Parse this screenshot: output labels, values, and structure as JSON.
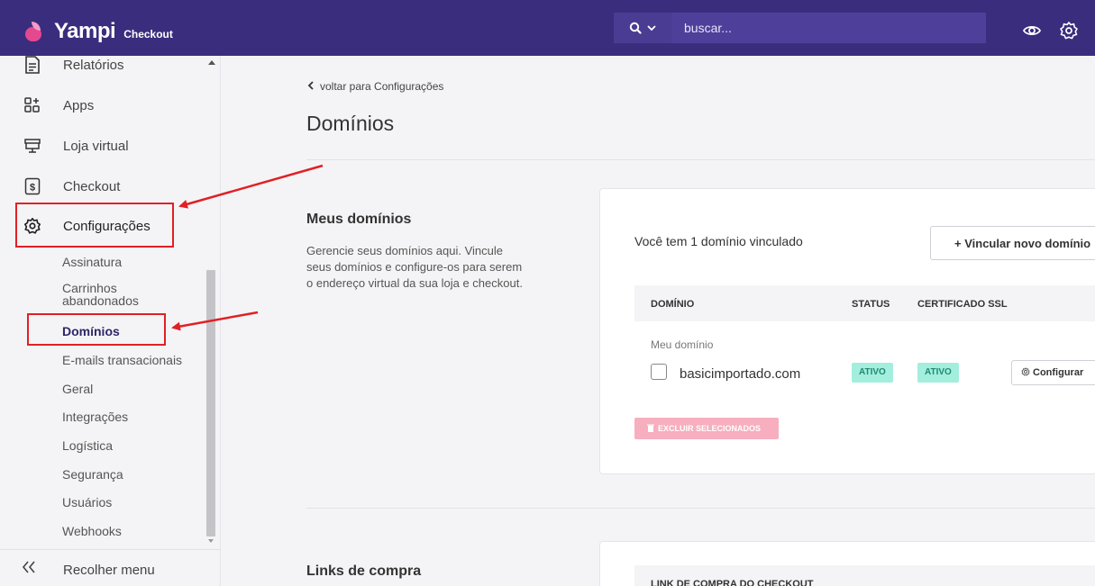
{
  "header": {
    "brand_name": "Yampi",
    "brand_sub": "Checkout",
    "search_placeholder": "buscar...",
    "colors": {
      "bar": "#3b2d7d",
      "search": "#4d3f9a",
      "logo_primary": "#e4488f",
      "logo_secondary": "#f79ac6"
    }
  },
  "sidebar": {
    "items": [
      {
        "label": "Relatórios",
        "icon": "report-icon"
      },
      {
        "label": "Apps",
        "icon": "apps-icon"
      },
      {
        "label": "Loja virtual",
        "icon": "store-icon"
      },
      {
        "label": "Checkout",
        "icon": "checkout-icon"
      },
      {
        "label": "Configurações",
        "icon": "gear-icon"
      }
    ],
    "subitems": [
      {
        "label": "Assinatura"
      },
      {
        "label": "Carrinhos abandonados"
      },
      {
        "label": "Domínios"
      },
      {
        "label": "E-mails transacionais"
      },
      {
        "label": "Geral"
      },
      {
        "label": "Integrações"
      },
      {
        "label": "Logística"
      },
      {
        "label": "Segurança"
      },
      {
        "label": "Usuários"
      },
      {
        "label": "Webhooks"
      }
    ],
    "collapse_label": "Recolher menu"
  },
  "main": {
    "back_link": "voltar para Configurações",
    "title": "Domínios",
    "domains_section": {
      "title": "Meus domínios",
      "description": "Gerencie seus domínios aqui. Vincule seus domínios e configure-os para serem o endereço virtual da sua loja e checkout.",
      "summary": "Você tem 1 domínio vinculado",
      "add_button": "+ Vincular novo domínio",
      "columns": [
        "DOMÍNIO",
        "STATUS",
        "CERTIFICADO SSL"
      ],
      "group_label": "Meu domínio",
      "rows": [
        {
          "domain": "basicimportado.com",
          "status": "ATIVO",
          "ssl": "ATIVO",
          "action": "Configurar"
        }
      ],
      "delete_button": "EXCLUIR SELECIONADOS"
    },
    "links_section": {
      "title": "Links de compra",
      "table_header": "LINK DE COMPRA DO CHECKOUT"
    }
  },
  "accent_colors": {
    "highlight": "#e12025",
    "badge_bg": "#a3eedd",
    "badge_text": "#1f8a72",
    "delete_bg": "#f7aebe"
  }
}
